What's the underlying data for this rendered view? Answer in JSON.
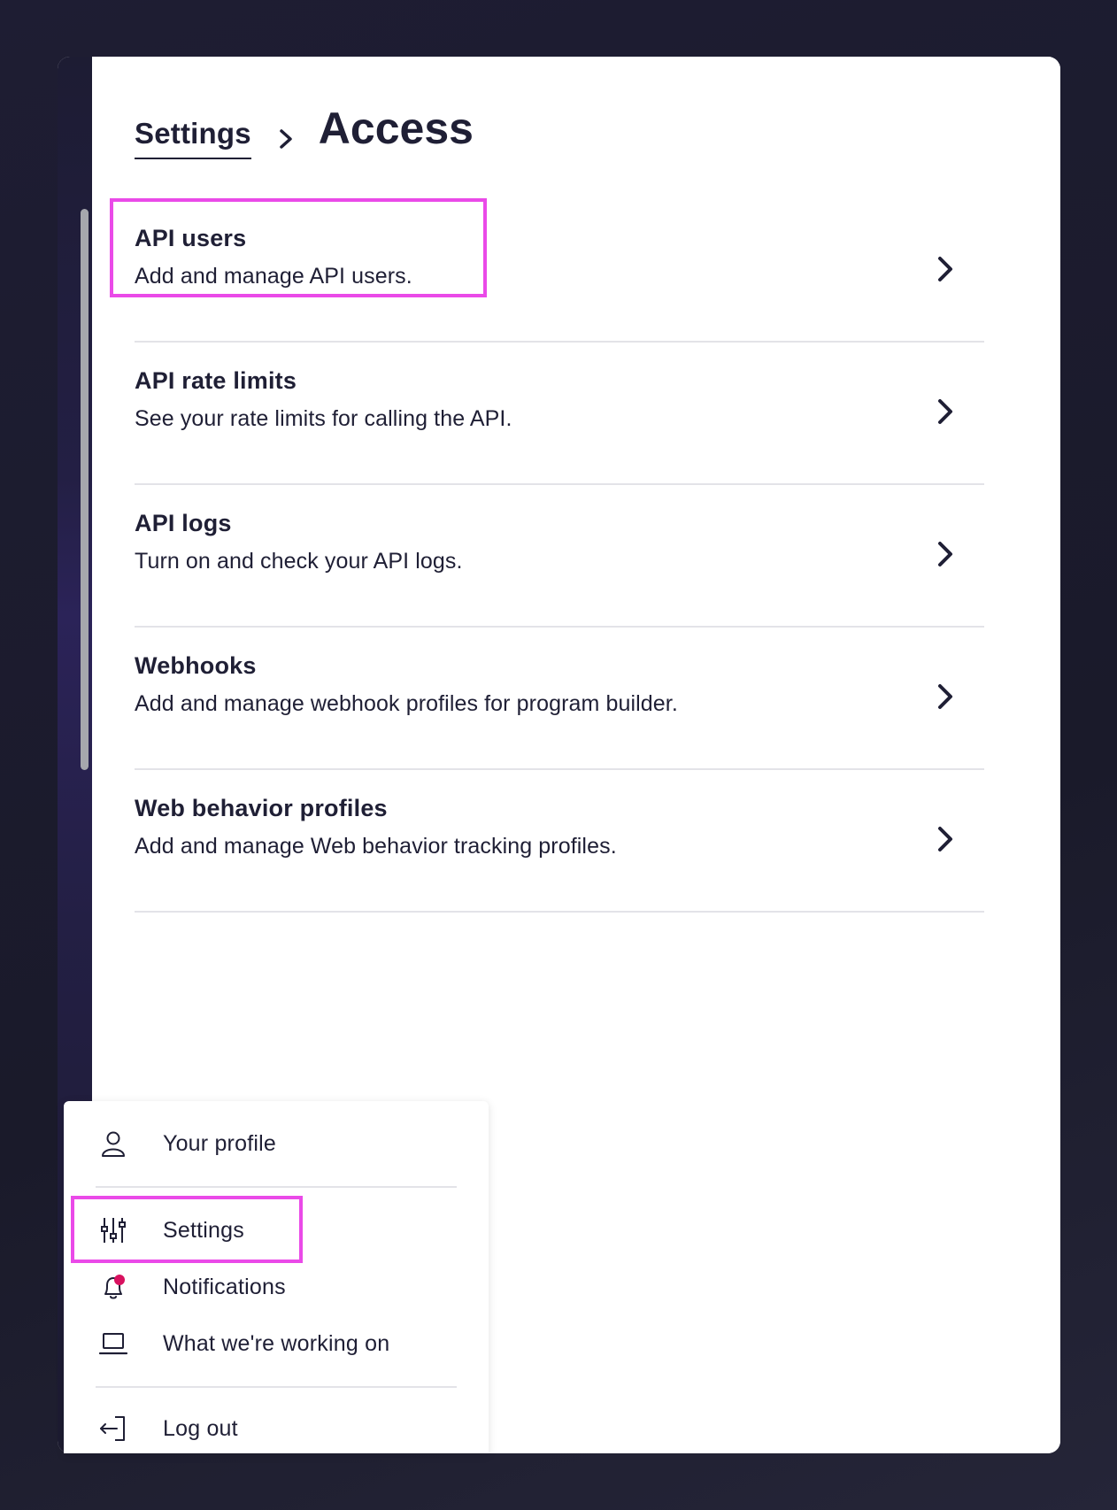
{
  "breadcrumb": {
    "parent": "Settings",
    "current": "Access"
  },
  "access_items": [
    {
      "title": "API users",
      "description": "Add and manage API users."
    },
    {
      "title": "API rate limits",
      "description": "See your rate limits for calling the API."
    },
    {
      "title": "API logs",
      "description": "Turn on and check your API logs."
    },
    {
      "title": "Webhooks",
      "description": "Add and manage webhook profiles for program builder."
    },
    {
      "title": "Web behavior profiles",
      "description": "Add and manage Web behavior tracking profiles."
    }
  ],
  "user_menu": {
    "profile": "Your profile",
    "settings": "Settings",
    "notifications": "Notifications",
    "working_on": "What we're working on",
    "logout": "Log out"
  },
  "colors": {
    "text": "#1f1f35",
    "highlight": "#ea4ae8",
    "notification_dot": "#d8115f",
    "divider": "#e3e3e8"
  },
  "icons": {
    "profile": "user-icon",
    "settings": "sliders-icon",
    "notifications": "bell-icon",
    "working_on": "laptop-icon",
    "logout": "logout-icon",
    "item_chevron": "chevron-right-icon"
  }
}
